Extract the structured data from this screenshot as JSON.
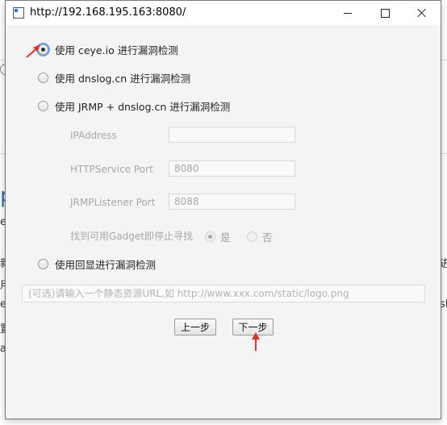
{
  "window": {
    "title": "http://192.168.195.163:8080/"
  },
  "options": {
    "ceye": "使用 ceye.io 进行漏洞检测",
    "dnslog": "使用 dnslog.cn 进行漏洞检测",
    "jrmp": "使用 JRMP + dnslog.cn 进行漏洞检测",
    "echo": "使用回显进行漏洞检测"
  },
  "jrmp_settings": {
    "ip_label": "IPAddress",
    "ip_value": "",
    "http_port_label": "HTTPService Port",
    "http_port_value": "8080",
    "listener_port_label": "JRMPListener Port",
    "listener_port_value": "8088",
    "stop_label": "找到可用Gadget即停止寻找",
    "yes_label": "是",
    "no_label": "否"
  },
  "url_field": {
    "placeholder": "(可选)请输入一个静态资源URL,如 http://www.xxx.com/static/logo.png"
  },
  "buttons": {
    "prev": "上一步",
    "next": "下一步"
  },
  "colors": {
    "annotation_arrow": "#e03030",
    "focus_ring": "#6aa6e8"
  },
  "background_page": {
    "fragments": [
      "e|",
      "新",
      "用",
      "e",
      "置",
      "at",
      "进",
      "sl"
    ],
    "big_letter": "p"
  }
}
